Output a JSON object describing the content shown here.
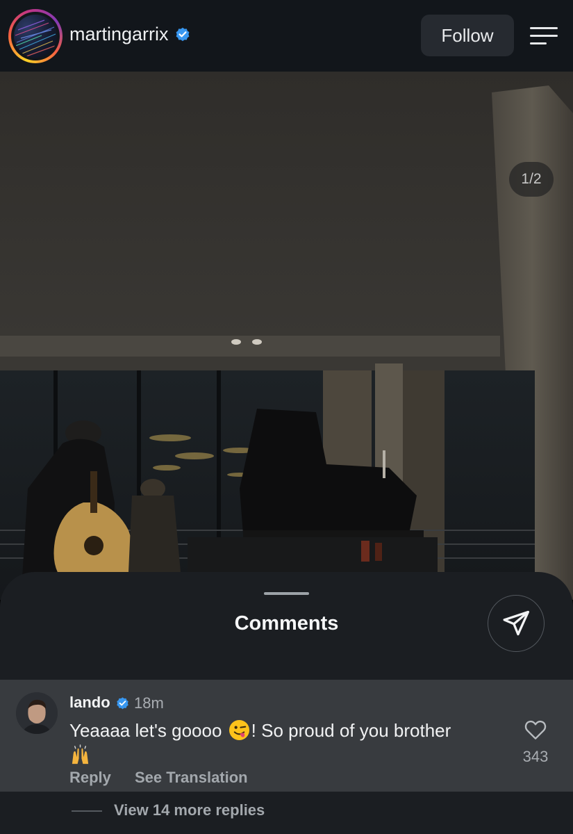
{
  "header": {
    "username": "martingarrix",
    "follow_label": "Follow",
    "icons": {
      "verified": "verified-badge-icon",
      "menu": "hamburger-menu-icon"
    }
  },
  "post": {
    "image_counter": "1/2"
  },
  "comments_sheet": {
    "title": "Comments",
    "share_icon": "paper-plane-icon",
    "comments": [
      {
        "username": "lando",
        "verified": true,
        "time": "18m",
        "text_before_emoji": "Yeaaaa let's goooo ",
        "text_after_emoji": "! So proud of you brother",
        "emojis": [
          "winking-face-with-tongue",
          "raising-hands"
        ],
        "reply_label": "Reply",
        "translate_label": "See Translation",
        "like_count": "343"
      }
    ],
    "view_more_label": "View 14 more replies"
  },
  "colors": {
    "topbar_bg": "#12161b",
    "sheet_bg": "#1b1e22",
    "comment_highlight_bg": "#383b3f",
    "verified_blue": "#3897f0"
  }
}
